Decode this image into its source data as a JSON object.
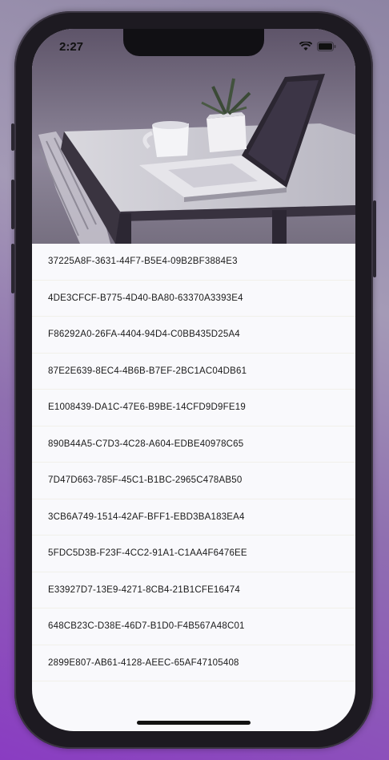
{
  "status_bar": {
    "time": "2:27"
  },
  "hero": {
    "description": ""
  },
  "list": {
    "items": [
      "37225A8F-3631-44F7-B5E4-09B2BF3884E3",
      "4DE3CFCF-B775-4D40-BA80-63370A3393E4",
      "F86292A0-26FA-4404-94D4-C0BB435D25A4",
      "87E2E639-8EC4-4B6B-B7EF-2BC1AC04DB61",
      "E1008439-DA1C-47E6-B9BE-14CFD9D9FE19",
      "890B44A5-C7D3-4C28-A604-EDBE40978C65",
      "7D47D663-785F-45C1-B1BC-2965C478AB50",
      "3CB6A749-1514-42AF-BFF1-EBD3BA183EA4",
      "5FDC5D3B-F23F-4CC2-91A1-C1AA4F6476EE",
      "E33927D7-13E9-4271-8CB4-21B1CFE16474",
      "648CB23C-D38E-46D7-B1D0-F4B567A48C01",
      "2899E807-AB61-4128-AEEC-65AF47105408"
    ]
  },
  "colors": {
    "accent": "#8a3cc2",
    "background": "#f9f9fc",
    "text": "#1a1a1a"
  },
  "icons": [
    "wifi-icon",
    "battery-icon"
  ]
}
